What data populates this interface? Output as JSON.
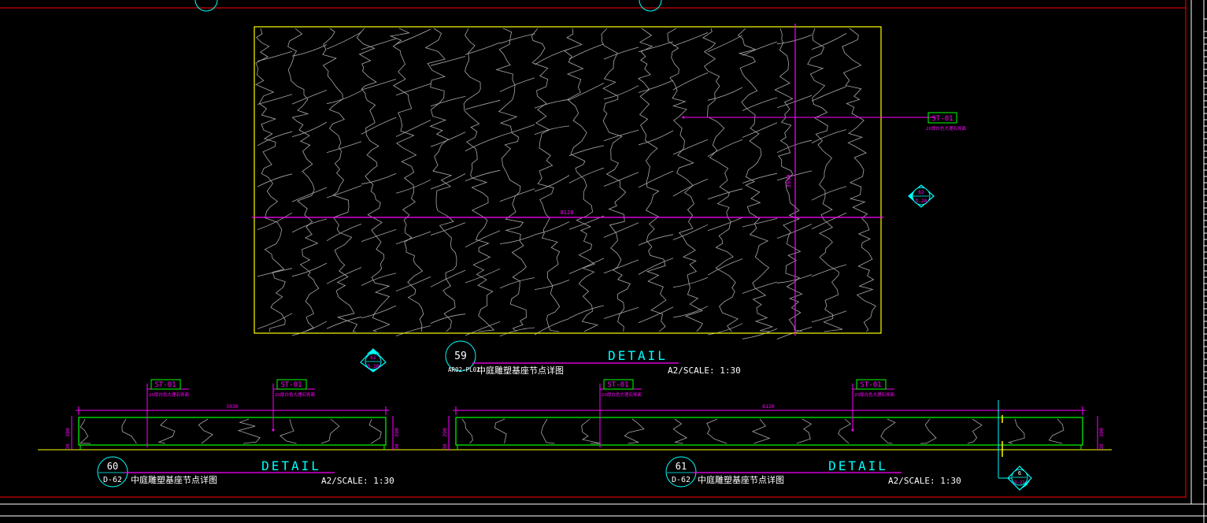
{
  "colors": {
    "background": "#000000",
    "frame": "#ff0000",
    "outline": "#ffff00",
    "dimension": "#ff00ff",
    "hatch": "#a8a8a8",
    "label": "#00ff00",
    "title": "#00ffff",
    "text": "#ffffff"
  },
  "top_detail": {
    "material_tag": "ST-01",
    "material_note": "20厚白色大理石饰面",
    "width_dim": "8120",
    "height_dim": "3930",
    "callout_right": {
      "num": "62",
      "sheet": "D-28"
    },
    "callout_left": {
      "num": "61",
      "sheet": "D-28"
    },
    "number": "59",
    "sheet_ref": "AR02-PL02",
    "word": "DETAIL",
    "name": "中庭雕塑基座节点详图",
    "scale": "A2/SCALE: 1:30"
  },
  "detail_60": {
    "number": "60",
    "sheet_ref": "D-62",
    "word": "DETAIL",
    "name": "中庭雕塑基座节点详图",
    "scale": "A2/SCALE: 1:30",
    "tag_1": "ST-01",
    "note_1": "20厚白色大理石饰面",
    "tag_2": "ST-01",
    "note_2": "20厚白色大理石饰面",
    "width_dim": "3930",
    "height_dim": "390",
    "side_dim": "30"
  },
  "detail_61": {
    "number": "61",
    "sheet_ref": "D-62",
    "word": "DETAIL",
    "name": "中庭雕塑基座节点详图",
    "scale": "A2/SCALE: 1:30",
    "tag_1": "ST-01",
    "note_1": "20厚白色大理石饰面",
    "tag_2": "ST-01",
    "note_2": "20厚白色大理石饰面",
    "width_dim": "8120",
    "height_dim": "390",
    "side_dim": "30",
    "callout": {
      "num": "6",
      "sheet": "D-27"
    }
  }
}
